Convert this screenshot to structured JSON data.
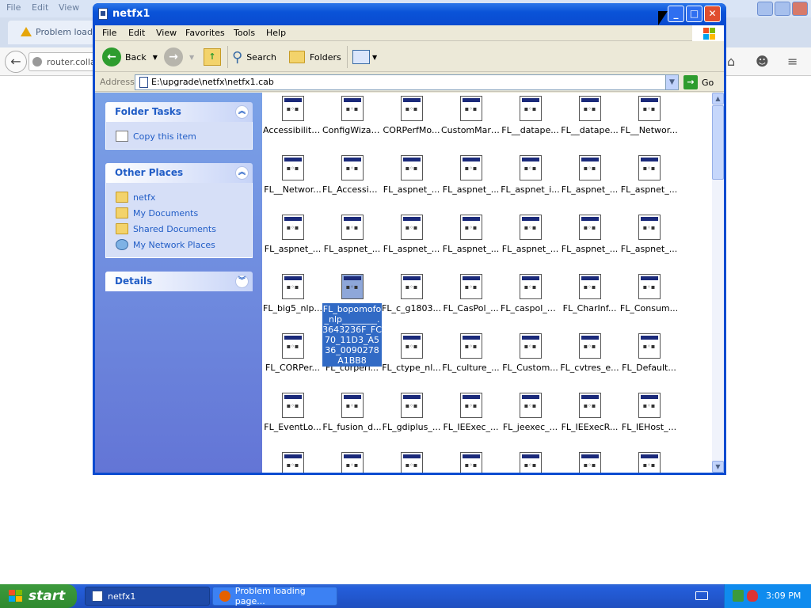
{
  "background": {
    "menu": [
      "File",
      "Edit",
      "View"
    ],
    "tab_title": "Problem loading",
    "url_text": "router.collab"
  },
  "window": {
    "title": "netfx1",
    "menu": [
      "File",
      "Edit",
      "View",
      "Favorites",
      "Tools",
      "Help"
    ],
    "toolbar": {
      "back": "Back",
      "search": "Search",
      "folders": "Folders"
    },
    "address": {
      "label": "Address",
      "value": "E:\\upgrade\\netfx\\netfx1.cab",
      "go": "Go"
    }
  },
  "taskpane": {
    "folder_tasks": {
      "title": "Folder Tasks",
      "items": [
        "Copy this item"
      ]
    },
    "other_places": {
      "title": "Other Places",
      "items": [
        "netfx",
        "My Documents",
        "Shared Documents",
        "My Network Places"
      ]
    },
    "details": {
      "title": "Details"
    }
  },
  "files": [
    "Accessibility...",
    "ConfigWizar...",
    "CORPerfMo...",
    "CustomMars...",
    "FL__datape...",
    "FL__datape...",
    "FL__Networ...",
    "FL__Networ...",
    "FL_Accessib...",
    "FL_aspnet_...",
    "FL_aspnet_...",
    "FL_aspnet_i...",
    "FL_aspnet_...",
    "FL_aspnet_...",
    "FL_aspnet_...",
    "FL_aspnet_...",
    "FL_aspnet_...",
    "FL_aspnet_...",
    "FL_aspnet_...",
    "FL_aspnet_...",
    "FL_aspnet_...",
    "FL_big5_nlp...",
    "FL_bopomofo_nlp________.3643236F_FC70_11D3_A536_0090278A1BB8",
    "FL_c_g1803...",
    "FL_CasPol_...",
    "FL_caspol_e...",
    "FL_CharInf...",
    "FL_Consum...",
    "FL_CORPer...",
    "FL_corperf...",
    "FL_ctype_nl...",
    "FL_culture_...",
    "FL_Custom...",
    "FL_cvtres_e...",
    "FL_Default...",
    "FL_EventLo...",
    "FL_fusion_d...",
    "FL_gdiplus_...",
    "FL_IEExec_...",
    "FL_jeexec_...",
    "FL_IEExecR...",
    "FL_IEHost_...",
    "",
    "",
    "",
    "",
    "",
    "",
    ""
  ],
  "selected_index": 22,
  "taskbar": {
    "start": "start",
    "tasks": [
      "netfx1",
      "Problem loading page..."
    ],
    "clock": "3:09 PM"
  }
}
